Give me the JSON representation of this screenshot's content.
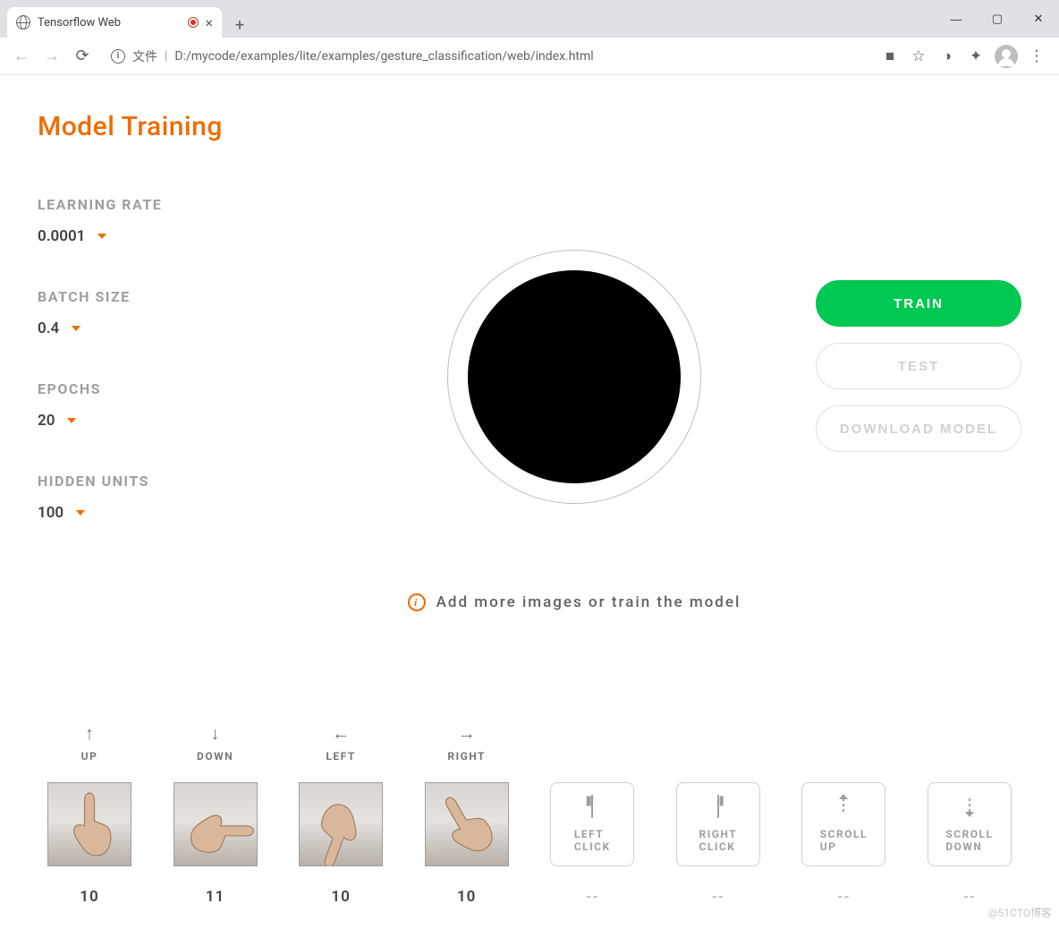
{
  "browser": {
    "tab_title": "Tensorflow Web",
    "url_prefix": "文件",
    "url": "D:/mycode/examples/lite/examples/gesture_classification/web/index.html"
  },
  "page": {
    "title": "Model Training",
    "hint": "Add more images or train the model"
  },
  "params": [
    {
      "label": "LEARNING RATE",
      "value": "0.0001"
    },
    {
      "label": "BATCH SIZE",
      "value": "0.4"
    },
    {
      "label": "EPOCHS",
      "value": "20"
    },
    {
      "label": "HIDDEN UNITS",
      "value": "100"
    }
  ],
  "actions": {
    "train": "TRAIN",
    "test": "TEST",
    "download": "DOWNLOAD MODEL"
  },
  "gestures": [
    {
      "icon": "arrow-up",
      "label": "UP",
      "has_thumb": true,
      "count": "10"
    },
    {
      "icon": "arrow-down",
      "label": "DOWN",
      "has_thumb": true,
      "count": "11"
    },
    {
      "icon": "arrow-left",
      "label": "LEFT",
      "has_thumb": true,
      "count": "10"
    },
    {
      "icon": "arrow-right",
      "label": "RIGHT",
      "has_thumb": true,
      "count": "10"
    },
    {
      "icon": "mouse-left",
      "label": "",
      "has_thumb": false,
      "box_label": "LEFT CLICK",
      "count": "--"
    },
    {
      "icon": "mouse-right",
      "label": "",
      "has_thumb": false,
      "box_label": "RIGHT CLICK",
      "count": "--"
    },
    {
      "icon": "dashed-up",
      "label": "",
      "has_thumb": false,
      "box_label": "SCROLL UP",
      "count": "--"
    },
    {
      "icon": "dashed-down",
      "label": "",
      "has_thumb": false,
      "box_label": "SCROLL DOWN",
      "count": "--"
    }
  ],
  "watermark": "@51CTO博客",
  "colors": {
    "accent": "#ef6c00",
    "train": "#00c853"
  }
}
